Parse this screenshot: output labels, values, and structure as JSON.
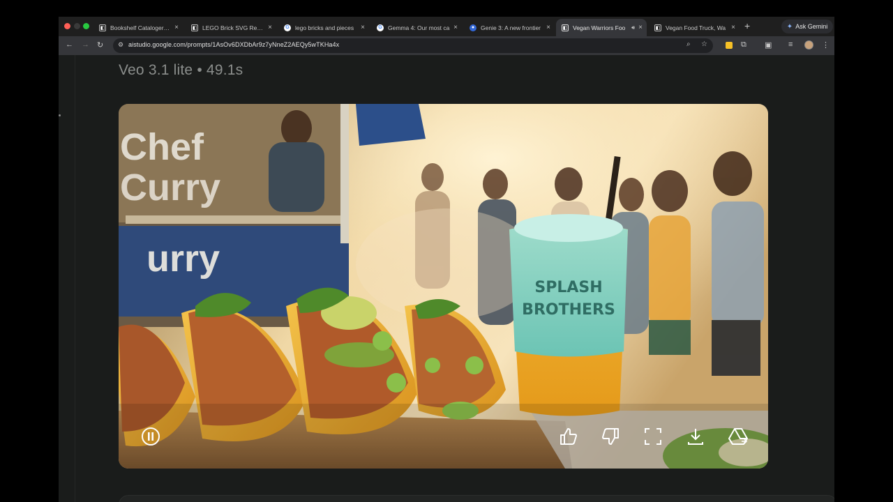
{
  "browser": {
    "tabs": [
      {
        "title": "Bookshelf Cataloger | G",
        "favicon": "studio-icon",
        "active": false
      },
      {
        "title": "LEGO Brick SVG Repres",
        "favicon": "studio-icon",
        "active": false
      },
      {
        "title": "lego bricks and pieces",
        "favicon": "google-icon",
        "active": false
      },
      {
        "title": "Gemma 4: Our most ca",
        "favicon": "google-icon",
        "active": false
      },
      {
        "title": "Genie 3: A new frontier",
        "favicon": "deepmind-icon",
        "active": false
      },
      {
        "title": "Vegan Warriors Foo",
        "favicon": "studio-icon",
        "active": true,
        "audio": true
      },
      {
        "title": "Vegan Food Truck, Wa",
        "favicon": "studio-icon",
        "active": false
      }
    ],
    "new_tab": "+",
    "ask_gemini": "Ask Gemini",
    "url": "aistudio.google.com/prompts/1AsOv6DXDbAr9z7yNneZ2AEQy5wTKHa4x"
  },
  "result": {
    "model_line": "Veo 3.1 lite • 49.1s"
  },
  "video": {
    "sign_text_1": "Chef",
    "sign_text_2": "Curry",
    "sign_text_3": "urry",
    "cup_text_1": "SPLASH",
    "cup_text_2": "BROTHERS",
    "state": "playing",
    "controls": [
      "pause-button",
      "thumbs-up-button",
      "thumbs-down-button",
      "fullscreen-button",
      "download-button",
      "save-to-drive-button"
    ]
  },
  "colors": {
    "page_bg": "#1a1c1b",
    "text_muted": "#8b8e8c",
    "tab_active": "#35363a"
  }
}
